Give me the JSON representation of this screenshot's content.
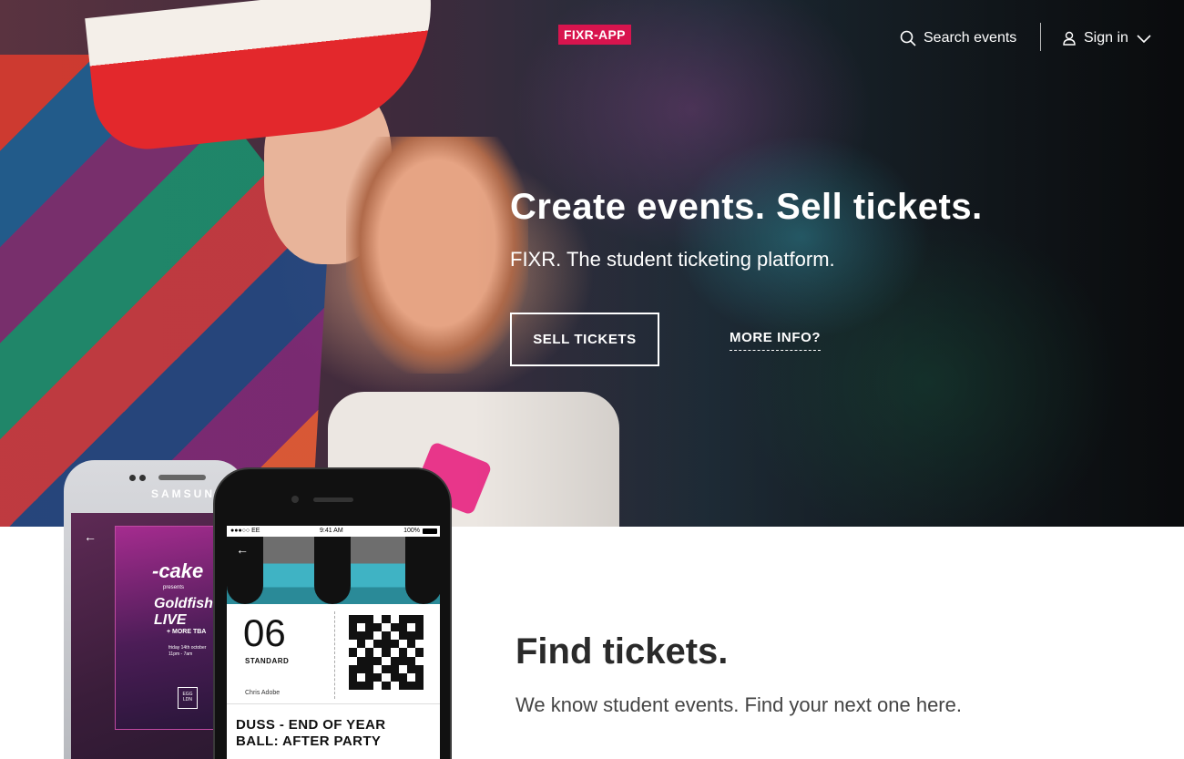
{
  "header": {
    "logo_text": "FIXR-APP",
    "search_label": "Search events",
    "signin_label": "Sign in",
    "accent_color": "#d8144e"
  },
  "hero": {
    "title": "Create events. Sell tickets.",
    "subtitle": "FIXR. The student ticketing platform.",
    "primary_button": "SELL TICKETS",
    "secondary_link": "MORE INFO?"
  },
  "find": {
    "title": "Find tickets.",
    "subtitle": "We know student events. Find your next one here."
  },
  "phone_back": {
    "brand": "SAMSUNG",
    "poster": {
      "headline": "-cake",
      "presents": "presents",
      "act": "Goldfish LIVE",
      "more": "+ MORE TBA",
      "date_line1": "friday 14th october",
      "date_line2": "11pm - 7am",
      "venue": "EGG LDN"
    }
  },
  "phone_front": {
    "status_left": "●●●○○ EE",
    "status_time": "9:41 AM",
    "status_battery": "100%",
    "ticket_number": "06",
    "ticket_type": "STANDARD",
    "ticket_owner": "Chris Adobe",
    "event_name": "DUSS - END OF YEAR BALL: AFTER PARTY"
  },
  "icons": {
    "search": "search-icon",
    "user": "user-icon",
    "chevron": "chevron-down-icon",
    "back_arrow": "back-arrow-icon"
  }
}
